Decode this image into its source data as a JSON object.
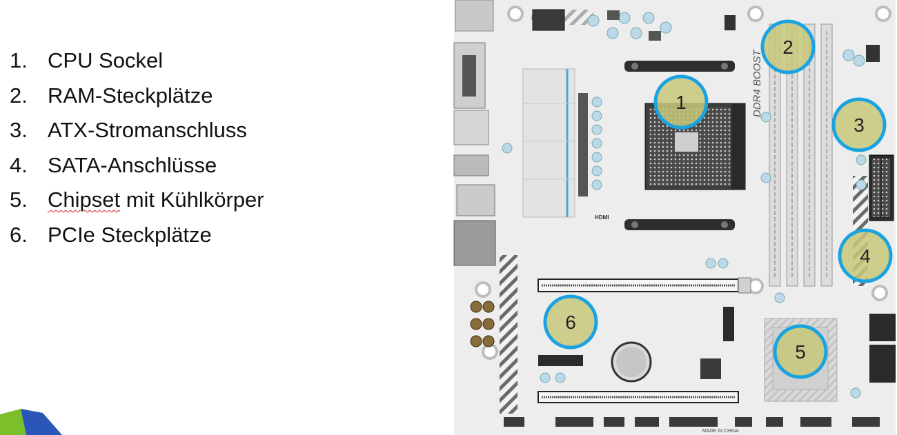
{
  "legend": {
    "items": [
      {
        "num": "1.",
        "pre": "CPU Sockel",
        "spell": "",
        "post": ""
      },
      {
        "num": "2.",
        "pre": "RAM-Steckplätze",
        "spell": "",
        "post": ""
      },
      {
        "num": "3.",
        "pre": "ATX-Stromanschluss",
        "spell": "",
        "post": ""
      },
      {
        "num": "4.",
        "pre": "SATA-Anschlüsse",
        "spell": "",
        "post": ""
      },
      {
        "num": "5.",
        "pre": "",
        "spell": "Chipset",
        "post": " mit Kühlkörper"
      },
      {
        "num": "6.",
        "pre": "PCIe Steckplätze",
        "spell": "",
        "post": ""
      }
    ]
  },
  "board": {
    "ram_label": "DDR4 BOOST",
    "hdmi_label": "HDMI",
    "made_in": "MADE IN CHINA",
    "markers": [
      "1",
      "2",
      "3",
      "4",
      "5",
      "6"
    ]
  },
  "colors": {
    "marker_ring": "#1aa3e0",
    "marker_fill": "#c8c87a",
    "board": "#efefef",
    "accent_blue": "#4aa8d8"
  }
}
